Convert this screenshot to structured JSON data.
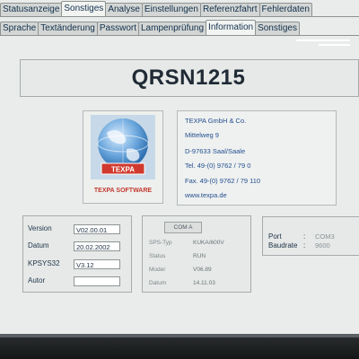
{
  "tabs_row1": [
    "Statusanzeige",
    "Sonstiges",
    "Analyse",
    "Einstellungen",
    "Referenzfahrt",
    "Fehlerdaten"
  ],
  "tabs_row2": [
    "Sprache",
    "Textänderung",
    "Passwort",
    "Lampenprüfung",
    "Information",
    "Sonstiges"
  ],
  "title": "QRSN1215",
  "logo": {
    "brand": "TEXPA",
    "caption": "TEXPA SOFTWARE"
  },
  "address": [
    "TEXPA GmbH & Co.",
    "Mittelweg 9",
    "D-97633 Saal/Saale",
    "Tel. 49-(0) 9762 / 79 0",
    "Fax. 49-(0) 9762 / 79 110",
    "www.texpa.de"
  ],
  "version_panel": {
    "version_label": "Version",
    "version_value": "V02.00.01",
    "datum_label": "Datum",
    "datum_value": "20.02.2002",
    "kpsys_label": "KPSYS32",
    "kpsys_value": "V3.12",
    "autor_label": "Autor",
    "autor_value": ""
  },
  "sps_panel": {
    "button": "COM A",
    "rows": [
      {
        "label": "SPS-Typ",
        "value": "KUKA/600V"
      },
      {
        "label": "Status",
        "value": "RUN"
      },
      {
        "label": "Moder",
        "value": "V06.89"
      },
      {
        "label": "Datum",
        "value": "14.11.03"
      }
    ]
  },
  "port_panel": {
    "port_label": "Port",
    "port_value": "COM3",
    "baud_label": "Baudrate",
    "baud_value": "9600"
  },
  "colors": {
    "screen_bg": "#e9ecea",
    "title_text": "#1f2a35",
    "address_text": "#264f8f",
    "logo_red": "#c2392d"
  }
}
